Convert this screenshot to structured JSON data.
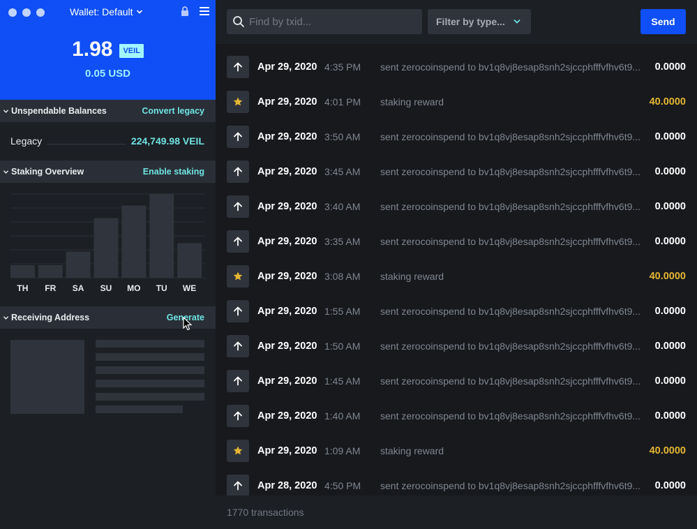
{
  "window": {
    "title": "Wallet: Default"
  },
  "header": {
    "balance": "1.98",
    "ticker": "VEIL",
    "usd": "0.05 USD"
  },
  "unspendable": {
    "title": "Unspendable Balances",
    "action": "Convert legacy",
    "legacy_label": "Legacy",
    "legacy_value": "224,749.98 VEIL"
  },
  "staking": {
    "title": "Staking Overview",
    "action": "Enable staking"
  },
  "receiving": {
    "title": "Receiving Address",
    "action": "Generate"
  },
  "search": {
    "placeholder": "Find by txid..."
  },
  "filter": {
    "label": "Filter by type..."
  },
  "send_label": "Send",
  "transactions": [
    {
      "type": "sent",
      "icon": "arrow-up-icon",
      "date": "Apr 29, 2020",
      "time": "4:35 PM",
      "desc": "sent zerocoinspend to bv1q8vj8esap8snh2sjccphfffvfhv6t9...",
      "amount": "0.0000"
    },
    {
      "type": "reward",
      "icon": "star-icon",
      "date": "Apr 29, 2020",
      "time": "4:01 PM",
      "desc": "staking reward",
      "amount": "40.0000"
    },
    {
      "type": "sent",
      "icon": "arrow-up-icon",
      "date": "Apr 29, 2020",
      "time": "3:50 AM",
      "desc": "sent zerocoinspend to bv1q8vj8esap8snh2sjccphfffvfhv6t9...",
      "amount": "0.0000"
    },
    {
      "type": "sent",
      "icon": "arrow-up-icon",
      "date": "Apr 29, 2020",
      "time": "3:45 AM",
      "desc": "sent zerocoinspend to bv1q8vj8esap8snh2sjccphfffvfhv6t9...",
      "amount": "0.0000"
    },
    {
      "type": "sent",
      "icon": "arrow-up-icon",
      "date": "Apr 29, 2020",
      "time": "3:40 AM",
      "desc": "sent zerocoinspend to bv1q8vj8esap8snh2sjccphfffvfhv6t9...",
      "amount": "0.0000"
    },
    {
      "type": "sent",
      "icon": "arrow-up-icon",
      "date": "Apr 29, 2020",
      "time": "3:35 AM",
      "desc": "sent zerocoinspend to bv1q8vj8esap8snh2sjccphfffvfhv6t9...",
      "amount": "0.0000"
    },
    {
      "type": "reward",
      "icon": "star-icon",
      "date": "Apr 29, 2020",
      "time": "3:08 AM",
      "desc": "staking reward",
      "amount": "40.0000"
    },
    {
      "type": "sent",
      "icon": "arrow-up-icon",
      "date": "Apr 29, 2020",
      "time": "1:55 AM",
      "desc": "sent zerocoinspend to bv1q8vj8esap8snh2sjccphfffvfhv6t9...",
      "amount": "0.0000"
    },
    {
      "type": "sent",
      "icon": "arrow-up-icon",
      "date": "Apr 29, 2020",
      "time": "1:50 AM",
      "desc": "sent zerocoinspend to bv1q8vj8esap8snh2sjccphfffvfhv6t9...",
      "amount": "0.0000"
    },
    {
      "type": "sent",
      "icon": "arrow-up-icon",
      "date": "Apr 29, 2020",
      "time": "1:45 AM",
      "desc": "sent zerocoinspend to bv1q8vj8esap8snh2sjccphfffvfhv6t9...",
      "amount": "0.0000"
    },
    {
      "type": "sent",
      "icon": "arrow-up-icon",
      "date": "Apr 29, 2020",
      "time": "1:40 AM",
      "desc": "sent zerocoinspend to bv1q8vj8esap8snh2sjccphfffvfhv6t9...",
      "amount": "0.0000"
    },
    {
      "type": "reward",
      "icon": "star-icon",
      "date": "Apr 29, 2020",
      "time": "1:09 AM",
      "desc": "staking reward",
      "amount": "40.0000"
    },
    {
      "type": "sent",
      "icon": "arrow-up-icon",
      "date": "Apr 28, 2020",
      "time": "4:50 PM",
      "desc": "sent zerocoinspend to bv1q8vj8esap8snh2sjccphfffvfhv6t9...",
      "amount": "0.0000"
    }
  ],
  "footer": {
    "count": "1770 transactions"
  },
  "colors": {
    "brand": "#0f4ff5",
    "accent": "#6fe3e2",
    "reward": "#e5b634",
    "sidebar_bg": "#1c1f24",
    "list_bg": "#17191d",
    "section_bg": "#2a2f37",
    "placeholder": "#2f343c"
  },
  "chart_data": {
    "type": "bar",
    "categories": [
      "TH",
      "FR",
      "SA",
      "SU",
      "MO",
      "TU",
      "WE"
    ],
    "values": [
      0.12,
      0.12,
      0.25,
      0.57,
      0.69,
      0.8,
      0.33
    ],
    "ylim": [
      0,
      0.8
    ],
    "grid": true
  }
}
